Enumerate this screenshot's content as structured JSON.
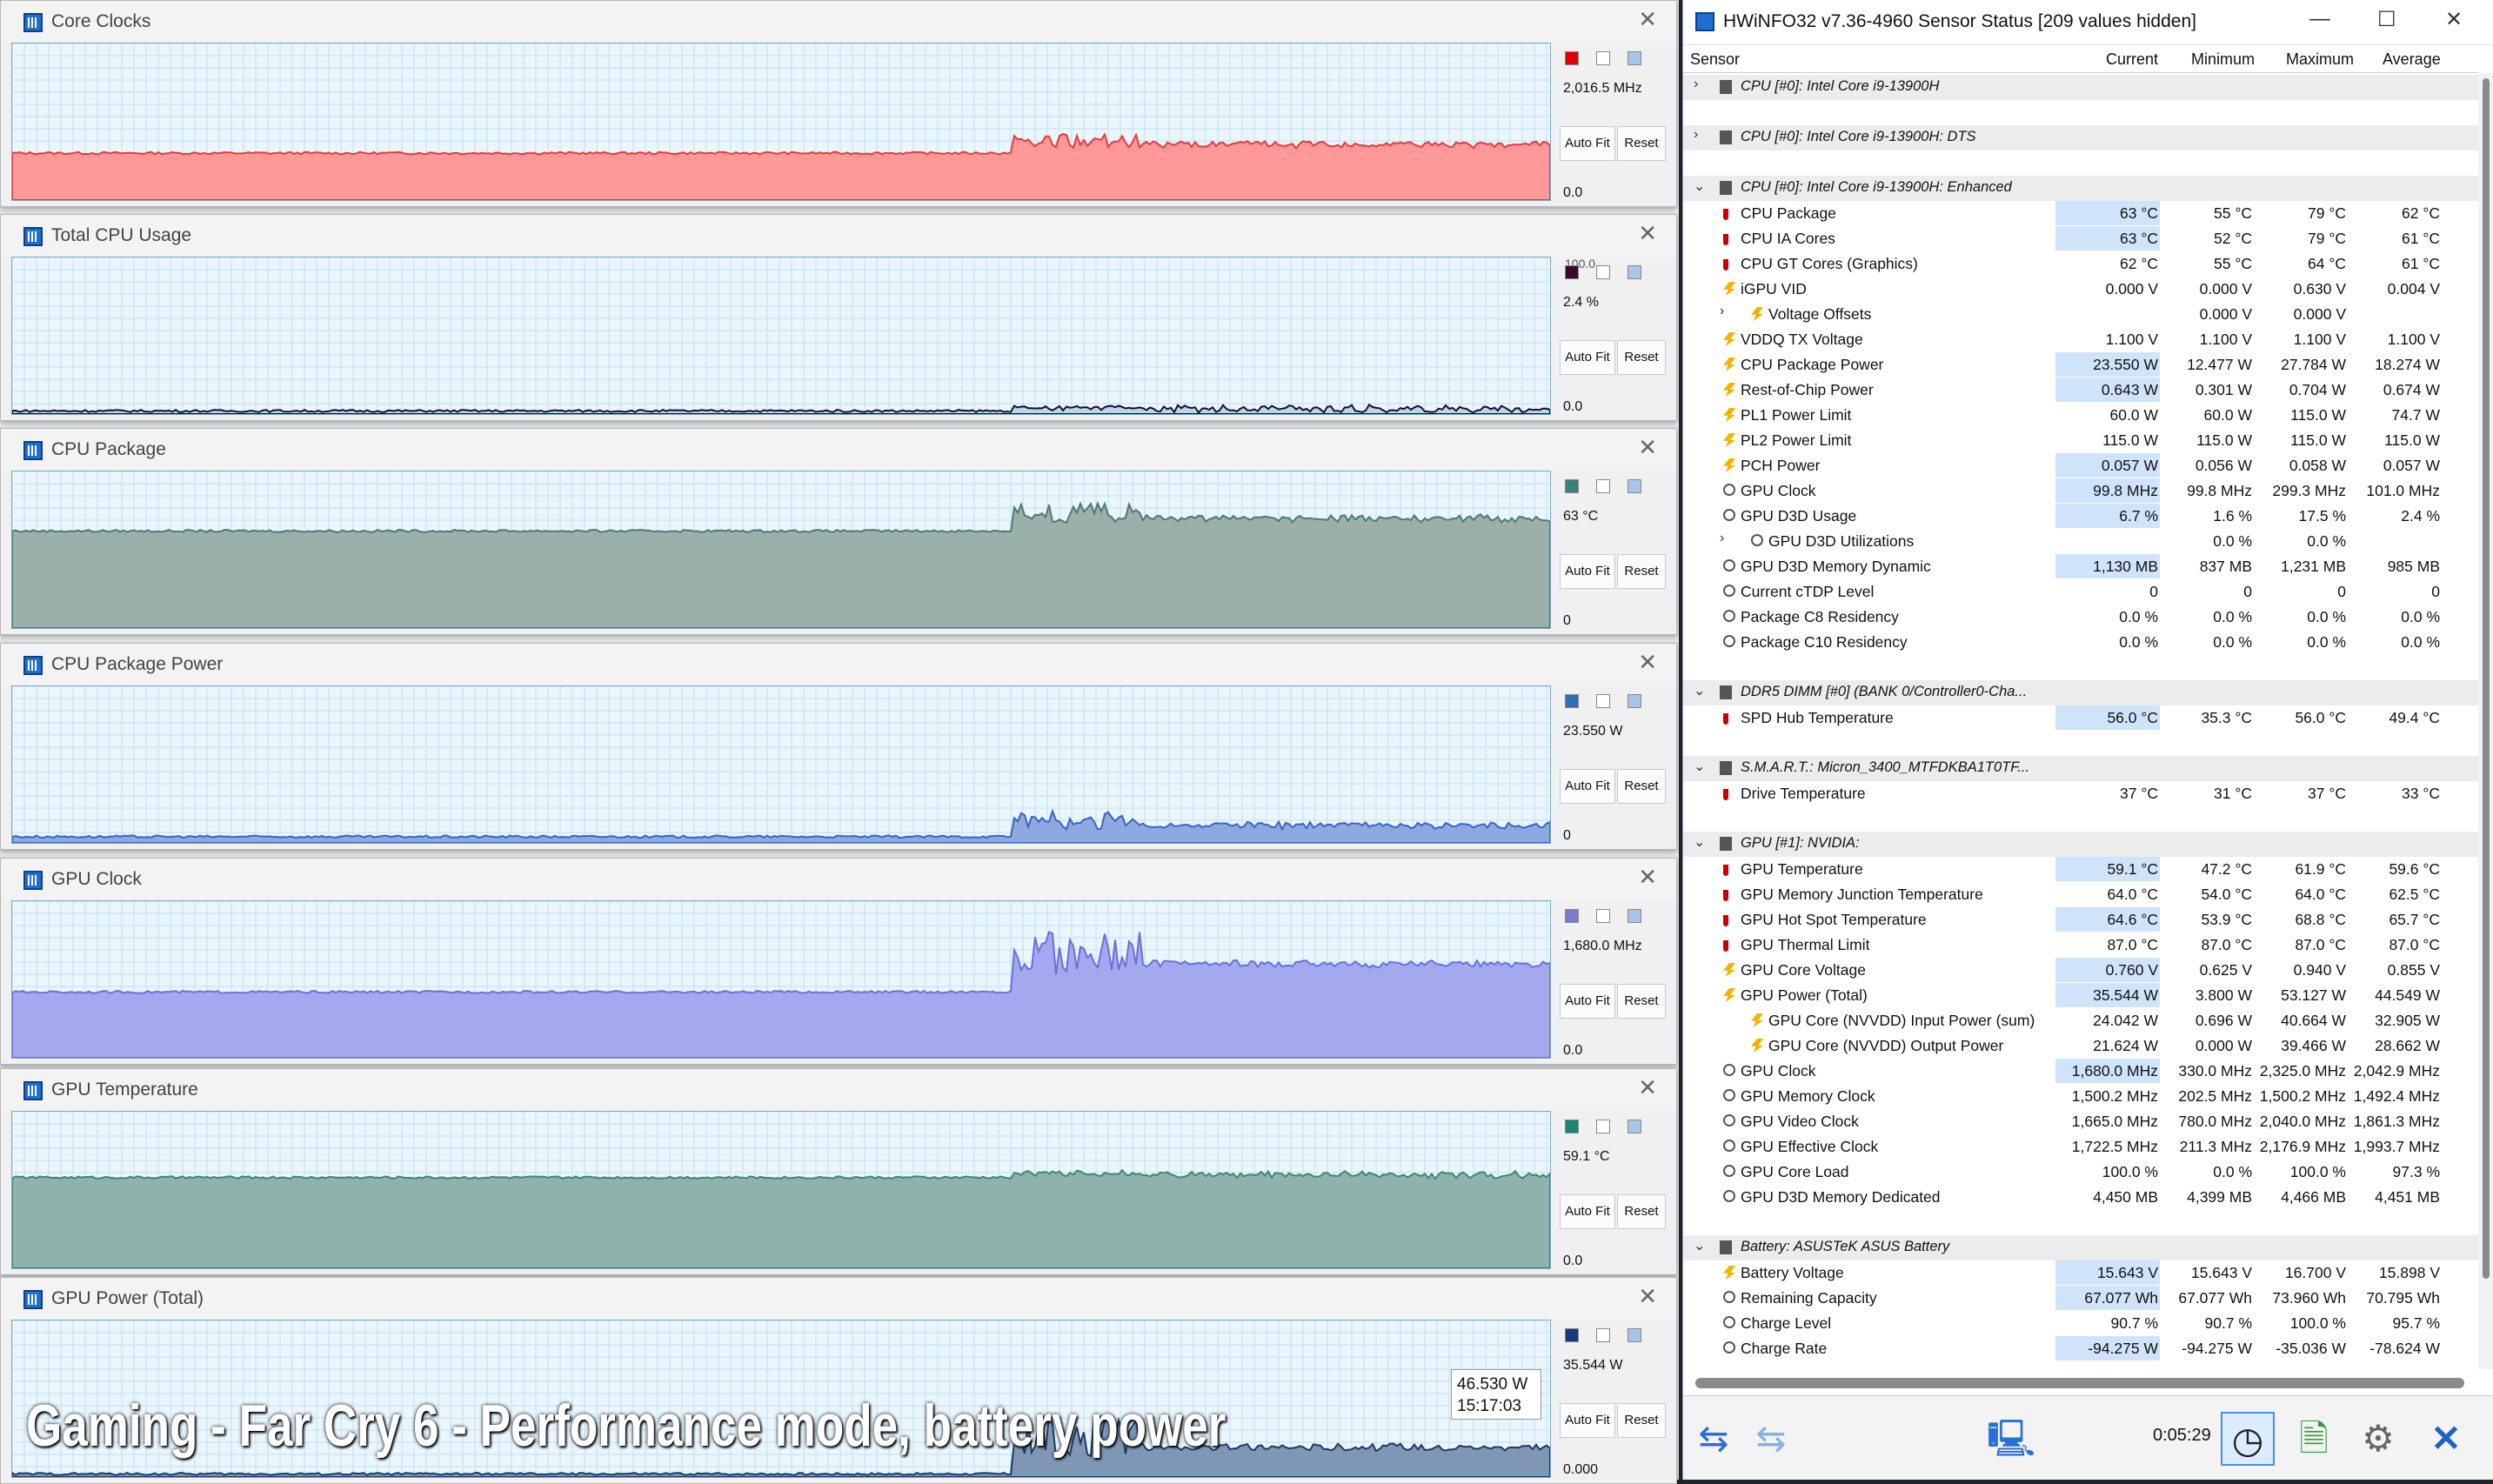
{
  "graphs": [
    {
      "title": "Core Clocks",
      "top_value": "",
      "current": "2,016.5 MHz",
      "min_value": "0.0",
      "color": "#ff9898",
      "line": "#e83a3a",
      "swatch": "#e00000",
      "base": 0.3,
      "peak": 0.42
    },
    {
      "title": "Total CPU Usage",
      "top_value": "100.0",
      "current": "2.4 %",
      "min_value": "0.0",
      "color": "#bcd4ef",
      "line": "#1a0f2a",
      "swatch": "#3a0a2a",
      "base": 0.02,
      "peak": 0.05
    },
    {
      "title": "CPU Package",
      "top_value": "",
      "current": "63 °C",
      "min_value": "0",
      "color": "#9bb0a8",
      "line": "#4d7a72",
      "swatch": "#3b7f7c",
      "base": 0.62,
      "peak": 0.8
    },
    {
      "title": "CPU Package Power",
      "top_value": "",
      "current": "23.550 W",
      "min_value": "0",
      "color": "#8ea8e0",
      "line": "#3b64c4",
      "swatch": "#2f6fb2",
      "base": 0.04,
      "peak": 0.2
    },
    {
      "title": "GPU Clock",
      "top_value": "",
      "current": "1,680.0 MHz",
      "min_value": "0.0",
      "color": "#a4a8ef",
      "line": "#6e6fd8",
      "swatch": "#7b7bd2",
      "base": 0.42,
      "peak": 0.82
    },
    {
      "title": "GPU Temperature",
      "top_value": "",
      "current": "59.1 °C",
      "min_value": "0.0",
      "color": "#8fb3ac",
      "line": "#3d8678",
      "swatch": "#1e8374",
      "base": 0.58,
      "peak": 0.62
    },
    {
      "title": "GPU Power (Total)",
      "top_value": "",
      "current": "35.544 W",
      "min_value": "0.000",
      "color": "#7f96b5",
      "line": "#1d3a66",
      "swatch": "#1a3a7a",
      "base": 0.02,
      "peak": 0.4
    }
  ],
  "graph_buttons": {
    "autofit": "Auto Fit",
    "reset": "Reset"
  },
  "tooltip": {
    "value": "46.530 W",
    "time": "15:17:03"
  },
  "overlay_caption": "Gaming - Far Cry 6 - Performance mode, battery power",
  "hwinfo": {
    "title": "HWiNFO32 v7.36-4960 Sensor Status [209 values hidden]",
    "columns": [
      "Sensor",
      "Current",
      "Minimum",
      "Maximum",
      "Average"
    ],
    "rows": [
      {
        "type": "grp",
        "label": "CPU [#0]: Intel Core i9-13900H",
        "exp": "›"
      },
      {
        "type": "blank"
      },
      {
        "type": "grp",
        "label": "CPU [#0]: Intel Core i9-13900H: DTS",
        "exp": "›"
      },
      {
        "type": "blank"
      },
      {
        "type": "grp",
        "label": "CPU [#0]: Intel Core i9-13900H: Enhanced",
        "exp": "⌄"
      },
      {
        "type": "r",
        "icon": "temp",
        "label": "CPU Package",
        "v": [
          "63 °C",
          "55 °C",
          "79 °C",
          "62 °C"
        ],
        "hl": true
      },
      {
        "type": "r",
        "icon": "temp",
        "label": "CPU IA Cores",
        "v": [
          "63 °C",
          "52 °C",
          "79 °C",
          "61 °C"
        ],
        "hl": true
      },
      {
        "type": "r",
        "icon": "temp",
        "label": "CPU GT Cores (Graphics)",
        "v": [
          "62 °C",
          "55 °C",
          "64 °C",
          "61 °C"
        ]
      },
      {
        "type": "r",
        "icon": "volt",
        "label": "iGPU VID",
        "v": [
          "0.000 V",
          "0.000 V",
          "0.630 V",
          "0.004 V"
        ]
      },
      {
        "type": "r",
        "icon": "volt",
        "label": "Voltage Offsets",
        "v": [
          "",
          "0.000 V",
          "0.000 V",
          ""
        ],
        "sub": true,
        "subexp": "›"
      },
      {
        "type": "r",
        "icon": "volt",
        "label": "VDDQ TX Voltage",
        "v": [
          "1.100 V",
          "1.100 V",
          "1.100 V",
          "1.100 V"
        ]
      },
      {
        "type": "r",
        "icon": "volt",
        "label": "CPU Package Power",
        "v": [
          "23.550 W",
          "12.477 W",
          "27.784 W",
          "18.274 W"
        ],
        "hl": true
      },
      {
        "type": "r",
        "icon": "volt",
        "label": "Rest-of-Chip Power",
        "v": [
          "0.643 W",
          "0.301 W",
          "0.704 W",
          "0.674 W"
        ],
        "hl": true
      },
      {
        "type": "r",
        "icon": "volt",
        "label": "PL1 Power Limit",
        "v": [
          "60.0 W",
          "60.0 W",
          "115.0 W",
          "74.7 W"
        ]
      },
      {
        "type": "r",
        "icon": "volt",
        "label": "PL2 Power Limit",
        "v": [
          "115.0 W",
          "115.0 W",
          "115.0 W",
          "115.0 W"
        ]
      },
      {
        "type": "r",
        "icon": "volt",
        "label": "PCH Power",
        "v": [
          "0.057 W",
          "0.056 W",
          "0.058 W",
          "0.057 W"
        ],
        "hl": true
      },
      {
        "type": "r",
        "icon": "clock",
        "label": "GPU Clock",
        "v": [
          "99.8 MHz",
          "99.8 MHz",
          "299.3 MHz",
          "101.0 MHz"
        ],
        "hl": true
      },
      {
        "type": "r",
        "icon": "clock",
        "label": "GPU D3D Usage",
        "v": [
          "6.7 %",
          "1.6 %",
          "17.5 %",
          "2.4 %"
        ],
        "hl": true
      },
      {
        "type": "r",
        "icon": "clock",
        "label": "GPU D3D Utilizations",
        "v": [
          "",
          "0.0 %",
          "0.0 %",
          ""
        ],
        "sub": true,
        "subexp": "›"
      },
      {
        "type": "r",
        "icon": "clock",
        "label": "GPU D3D Memory Dynamic",
        "v": [
          "1,130 MB",
          "837 MB",
          "1,231 MB",
          "985 MB"
        ],
        "hl": true
      },
      {
        "type": "r",
        "icon": "clock",
        "label": "Current cTDP Level",
        "v": [
          "0",
          "0",
          "0",
          "0"
        ]
      },
      {
        "type": "r",
        "icon": "clock",
        "label": "Package C8 Residency",
        "v": [
          "0.0 %",
          "0.0 %",
          "0.0 %",
          "0.0 %"
        ]
      },
      {
        "type": "r",
        "icon": "clock",
        "label": "Package C10 Residency",
        "v": [
          "0.0 %",
          "0.0 %",
          "0.0 %",
          "0.0 %"
        ]
      },
      {
        "type": "blank"
      },
      {
        "type": "grp",
        "label": "DDR5 DIMM [#0] (BANK 0/Controller0-Cha...",
        "exp": "⌄"
      },
      {
        "type": "r",
        "icon": "temp",
        "label": "SPD Hub Temperature",
        "v": [
          "56.0 °C",
          "35.3 °C",
          "56.0 °C",
          "49.4 °C"
        ],
        "hl": true
      },
      {
        "type": "blank"
      },
      {
        "type": "grp",
        "label": "S.M.A.R.T.: Micron_3400_MTFDKBA1T0TF...",
        "exp": "⌄"
      },
      {
        "type": "r",
        "icon": "temp",
        "label": "Drive Temperature",
        "v": [
          "37 °C",
          "31 °C",
          "37 °C",
          "33 °C"
        ]
      },
      {
        "type": "blank"
      },
      {
        "type": "grp",
        "label": "GPU [#1]: NVIDIA:",
        "exp": "⌄"
      },
      {
        "type": "r",
        "icon": "temp",
        "label": "GPU Temperature",
        "v": [
          "59.1 °C",
          "47.2 °C",
          "61.9 °C",
          "59.6 °C"
        ],
        "hl": true
      },
      {
        "type": "r",
        "icon": "temp",
        "label": "GPU Memory Junction Temperature",
        "v": [
          "64.0 °C",
          "54.0 °C",
          "64.0 °C",
          "62.5 °C"
        ]
      },
      {
        "type": "r",
        "icon": "temp",
        "label": "GPU Hot Spot Temperature",
        "v": [
          "64.6 °C",
          "53.9 °C",
          "68.8 °C",
          "65.7 °C"
        ],
        "hl": true
      },
      {
        "type": "r",
        "icon": "temp",
        "label": "GPU Thermal Limit",
        "v": [
          "87.0 °C",
          "87.0 °C",
          "87.0 °C",
          "87.0 °C"
        ]
      },
      {
        "type": "r",
        "icon": "volt",
        "label": "GPU Core Voltage",
        "v": [
          "0.760 V",
          "0.625 V",
          "0.940 V",
          "0.855 V"
        ],
        "hl": true
      },
      {
        "type": "r",
        "icon": "volt",
        "label": "GPU Power (Total)",
        "v": [
          "35.544 W",
          "3.800 W",
          "53.127 W",
          "44.549 W"
        ],
        "hl": true
      },
      {
        "type": "r",
        "icon": "volt",
        "label": "GPU Core (NVVDD) Input Power (sum)",
        "v": [
          "24.042 W",
          "0.696 W",
          "40.664 W",
          "32.905 W"
        ],
        "sub": true
      },
      {
        "type": "r",
        "icon": "volt",
        "label": "GPU Core (NVVDD) Output Power",
        "v": [
          "21.624 W",
          "0.000 W",
          "39.466 W",
          "28.662 W"
        ],
        "sub": true
      },
      {
        "type": "r",
        "icon": "clock",
        "label": "GPU Clock",
        "v": [
          "1,680.0 MHz",
          "330.0 MHz",
          "2,325.0 MHz",
          "2,042.9 MHz"
        ],
        "hl": true
      },
      {
        "type": "r",
        "icon": "clock",
        "label": "GPU Memory Clock",
        "v": [
          "1,500.2 MHz",
          "202.5 MHz",
          "1,500.2 MHz",
          "1,492.4 MHz"
        ]
      },
      {
        "type": "r",
        "icon": "clock",
        "label": "GPU Video Clock",
        "v": [
          "1,665.0 MHz",
          "780.0 MHz",
          "2,040.0 MHz",
          "1,861.3 MHz"
        ]
      },
      {
        "type": "r",
        "icon": "clock",
        "label": "GPU Effective Clock",
        "v": [
          "1,722.5 MHz",
          "211.3 MHz",
          "2,176.9 MHz",
          "1,993.7 MHz"
        ]
      },
      {
        "type": "r",
        "icon": "clock",
        "label": "GPU Core Load",
        "v": [
          "100.0 %",
          "0.0 %",
          "100.0 %",
          "97.3 %"
        ]
      },
      {
        "type": "r",
        "icon": "clock",
        "label": "GPU D3D Memory Dedicated",
        "v": [
          "4,450 MB",
          "4,399 MB",
          "4,466 MB",
          "4,451 MB"
        ]
      },
      {
        "type": "blank"
      },
      {
        "type": "grp",
        "label": "Battery: ASUSTeK ASUS Battery",
        "exp": "⌄"
      },
      {
        "type": "r",
        "icon": "volt",
        "label": "Battery Voltage",
        "v": [
          "15.643 V",
          "15.643 V",
          "16.700 V",
          "15.898 V"
        ],
        "hl": true
      },
      {
        "type": "r",
        "icon": "clock",
        "label": "Remaining Capacity",
        "v": [
          "67.077 Wh",
          "67.077 Wh",
          "73.960 Wh",
          "70.795 Wh"
        ],
        "hl": true
      },
      {
        "type": "r",
        "icon": "clock",
        "label": "Charge Level",
        "v": [
          "90.7 %",
          "90.7 %",
          "100.0 %",
          "95.7 %"
        ]
      },
      {
        "type": "r",
        "icon": "clock",
        "label": "Charge Rate",
        "v": [
          "-94.275 W",
          "-94.275 W",
          "-35.036 W",
          "-78.624 W"
        ],
        "hl": true
      }
    ],
    "elapsed": "0:05:29"
  }
}
